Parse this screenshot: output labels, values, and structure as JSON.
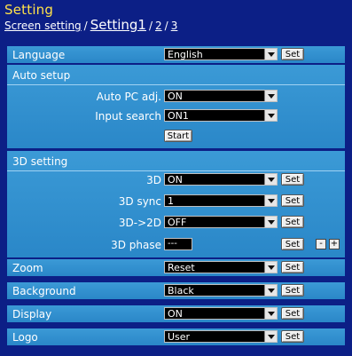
{
  "page": {
    "title": "Setting"
  },
  "breadcrumb": {
    "screen_setting": "Screen setting",
    "separator": "/",
    "current": "Setting1",
    "page2": "2",
    "page3": "3"
  },
  "language": {
    "label": "Language",
    "value": "English",
    "set": "Set"
  },
  "auto_setup": {
    "header": "Auto setup",
    "auto_pc_label": "Auto PC adj.",
    "auto_pc_value": "ON",
    "input_search_label": "Input search",
    "input_search_value": "ON1",
    "start": "Start"
  },
  "setting_3d": {
    "header": "3D setting",
    "d3_label": "3D",
    "d3_value": "ON",
    "sync_label": "3D sync",
    "sync_value": "1",
    "to2d_label": "3D->2D",
    "to2d_value": "OFF",
    "phase_label": "3D phase",
    "phase_value": "---",
    "set": "Set",
    "minus": "-",
    "plus": "+"
  },
  "zoom": {
    "label": "Zoom",
    "value": "Reset",
    "set": "Set"
  },
  "background": {
    "label": "Background",
    "value": "Black",
    "set": "Set"
  },
  "display": {
    "label": "Display",
    "value": "ON",
    "set": "Set"
  },
  "logo": {
    "label": "Logo",
    "value": "User",
    "set": "Set"
  },
  "colors": {
    "page_bg": "#0c1f86",
    "title": "#ffe24a",
    "row_bg": "#3b9ad6",
    "select_bg": "#000000"
  }
}
